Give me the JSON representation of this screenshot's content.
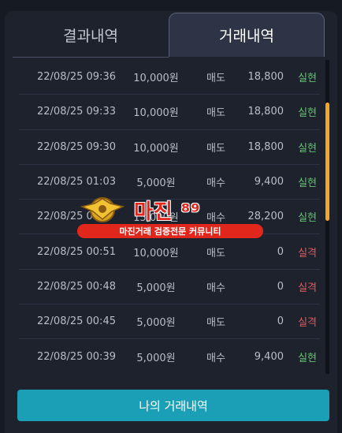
{
  "tabs": {
    "left_label": "결과내역",
    "right_label": "거래내역"
  },
  "trades": [
    {
      "time": "22/08/25 09:36",
      "amount": "10,000원",
      "type": "매도",
      "price": "18,800",
      "result": "실현",
      "status": "ok"
    },
    {
      "time": "22/08/25 09:33",
      "amount": "10,000원",
      "type": "매도",
      "price": "18,800",
      "result": "실현",
      "status": "ok"
    },
    {
      "time": "22/08/25 09:30",
      "amount": "10,000원",
      "type": "매도",
      "price": "18,800",
      "result": "실현",
      "status": "ok"
    },
    {
      "time": "22/08/25 01:03",
      "amount": "5,000원",
      "type": "매수",
      "price": "9,400",
      "result": "실현",
      "status": "ok"
    },
    {
      "time": "22/08/25 00:5",
      "amount": "15,000원",
      "type": "매수",
      "price": "28,200",
      "result": "실현",
      "status": "ok"
    },
    {
      "time": "22/08/25 00:51",
      "amount": "10,000원",
      "type": "매도",
      "price": "0",
      "result": "실격",
      "status": "fail"
    },
    {
      "time": "22/08/25 00:48",
      "amount": "5,000원",
      "type": "매수",
      "price": "0",
      "result": "실격",
      "status": "fail"
    },
    {
      "time": "22/08/25 00:45",
      "amount": "5,000원",
      "type": "매도",
      "price": "0",
      "result": "실격",
      "status": "fail"
    },
    {
      "time": "22/08/25 00:39",
      "amount": "5,000원",
      "type": "매수",
      "price": "9,400",
      "result": "실현",
      "status": "ok"
    }
  ],
  "button": {
    "label": "나의 거래내역"
  },
  "watermark": {
    "logo": "마진",
    "slogan": "마진거래 검증전문 커뮤니티"
  },
  "colors": {
    "accent": "#1a9fb6",
    "scroll": "#f5a623",
    "ok": "#5fc46d",
    "fail": "#e05a5a"
  }
}
